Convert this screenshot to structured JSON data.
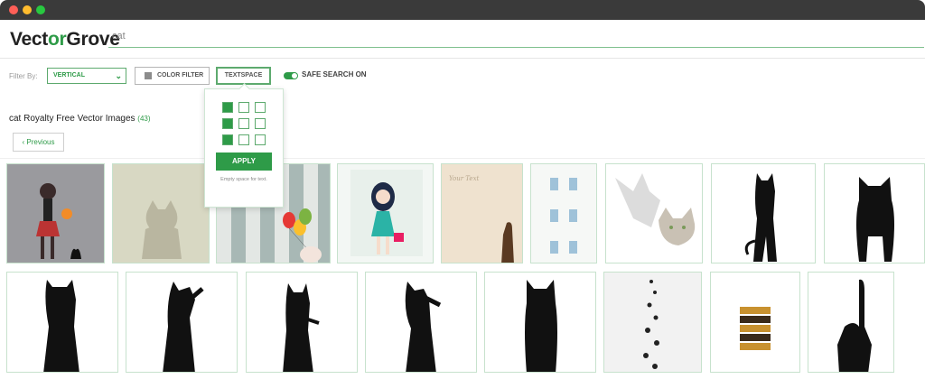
{
  "window": {
    "controls": [
      "close",
      "minimize",
      "zoom"
    ]
  },
  "logo": {
    "part1": "Vect",
    "part2": "or",
    "part3": "Grove"
  },
  "search": {
    "value": "cat"
  },
  "filters": {
    "label": "Filter By:",
    "orientation": "VERTICAL",
    "color_filter": "COLOR FILTER",
    "textspace": "TEXTSPACE",
    "safe_search": "SAFE SEARCH ON"
  },
  "textspace_popup": {
    "grid": [
      [
        true,
        false,
        false
      ],
      [
        true,
        false,
        false
      ],
      [
        true,
        false,
        false
      ]
    ],
    "apply_label": "APPLY",
    "hint": "Empty space for text."
  },
  "results": {
    "title": "cat Royalty Free Vector Images",
    "count": "(43)",
    "prev_label": "‹ Previous"
  },
  "thumbnails": {
    "row1": [
      "witch-girl-with-pumpkin",
      "gray-cat-pattern",
      "balloons-and-kitten",
      "girl-with-handbag",
      "your-text-cat-card",
      "cats-on-windows",
      "cat-with-shadow",
      "cat-silhouette-standing",
      "cat-silhouette-front"
    ],
    "row2": [
      "cat-silhouette-reaching",
      "cat-silhouette-climbing",
      "cat-silhouette-sitting",
      "cat-silhouette-pawing",
      "cat-silhouette-back",
      "paw-prints-trail",
      "leopard-pattern-bars",
      "cat-silhouette-tail-up"
    ]
  },
  "colors": {
    "brand": "#2e9b48",
    "border": "#c7e2cd"
  }
}
